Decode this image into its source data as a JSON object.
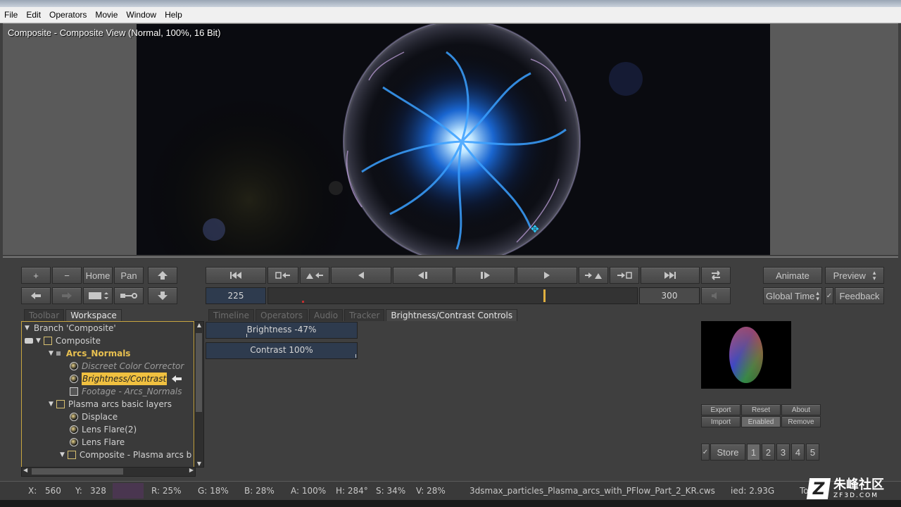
{
  "menu": [
    "File",
    "Edit",
    "Operators",
    "Movie",
    "Window",
    "Help"
  ],
  "viewer": {
    "title": "Composite - Composite View (Normal, 100%, 16 Bit)"
  },
  "toolbar": {
    "plus": "+",
    "minus": "−",
    "home": "Home",
    "pan": "Pan"
  },
  "transport": {
    "current_frame": "225",
    "end_frame": "300"
  },
  "right_buttons": {
    "animate": "Animate",
    "preview": "Preview",
    "global_time": "Global Time",
    "feedback": "Feedback"
  },
  "left_tabs": [
    "Toolbar",
    "Workspace"
  ],
  "center_tabs": [
    "Timeline",
    "Operators",
    "Audio",
    "Tracker",
    "Brightness/Contrast Controls"
  ],
  "controls": {
    "brightness": "Brightness -47%",
    "contrast": "Contrast 100%"
  },
  "tree": [
    {
      "label": "Branch 'Composite'",
      "indent": 0
    },
    {
      "label": "Composite",
      "indent": 1
    },
    {
      "label": "Arcs_Normals",
      "indent": 2
    },
    {
      "label": "Discreet Color Corrector",
      "indent": 3
    },
    {
      "label": "Brightness/Contrast",
      "indent": 3
    },
    {
      "label": "Footage - Arcs_Normals",
      "indent": 3
    },
    {
      "label": "Plasma arcs basic layers",
      "indent": 2
    },
    {
      "label": "Displace",
      "indent": 3
    },
    {
      "label": "Lens Flare(2)",
      "indent": 3
    },
    {
      "label": "Lens Flare",
      "indent": 3
    },
    {
      "label": "Composite - Plasma arcs b",
      "indent": 3
    }
  ],
  "plugin_buttons": {
    "export": "Export",
    "reset": "Reset",
    "about": "About",
    "import": "Import",
    "enabled": "Enabled",
    "remove": "Remove"
  },
  "store": {
    "label": "Store",
    "slots": [
      "1",
      "2",
      "3",
      "4",
      "5"
    ]
  },
  "status": {
    "x_label": "X:",
    "x": "560",
    "y_label": "Y:",
    "y": "328",
    "r": "R: 25%",
    "g": "G: 18%",
    "b": "B: 28%",
    "a": "A: 100%",
    "h": "H: 284°",
    "s": "S: 34%",
    "v": "V: 28%",
    "file": "3dsmax_particles_Plasma_arcs_with_PFlow_Part_2_KR.cws",
    "mem": "ied: 2.93G",
    "to": "To"
  },
  "watermark": {
    "text": "朱峰社区",
    "sub": "ZF3D.COM"
  },
  "colors": {
    "accent": "#c8a640",
    "swatch": "#4a3650",
    "timeline_marker": "#e0b040"
  }
}
